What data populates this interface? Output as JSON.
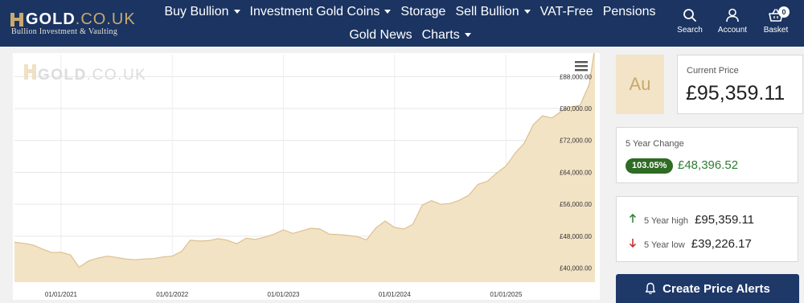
{
  "brand": {
    "name_main": "GOLD",
    "name_tld": ".CO.UK",
    "tagline": "Bullion Investment & Vaulting",
    "watermark_main": "GOLD",
    "watermark_tld": ".CO.UK"
  },
  "nav": {
    "row1": [
      {
        "label": "Buy Bullion",
        "dropdown": true
      },
      {
        "label": "Investment Gold Coins",
        "dropdown": true
      },
      {
        "label": "Storage",
        "dropdown": false
      },
      {
        "label": "Sell Bullion",
        "dropdown": true
      },
      {
        "label": "VAT-Free",
        "dropdown": false
      },
      {
        "label": "Pensions",
        "dropdown": false
      }
    ],
    "row2": [
      {
        "label": "Gold News",
        "dropdown": false
      },
      {
        "label": "Charts",
        "dropdown": true
      }
    ]
  },
  "header_icons": {
    "search_label": "Search",
    "account_label": "Account",
    "basket_label": "Basket",
    "basket_count": "0"
  },
  "metal": {
    "symbol": "Au"
  },
  "price": {
    "label": "Current Price",
    "value": "£95,359.11"
  },
  "change": {
    "label": "5 Year Change",
    "percent": "103.05%",
    "absolute": "£48,396.52"
  },
  "highlow": {
    "high_label": "5 Year high",
    "high_value": "£95,359.11",
    "low_label": "5 Year low",
    "low_value": "£39,226.17"
  },
  "alert_button": "Create Price Alerts",
  "colors": {
    "header_bg": "#1b3461",
    "area_fill": "#f3e3c5",
    "area_line": "#dcc08e",
    "positive": "#2e7d32",
    "pill_bg": "#2e6b23",
    "up_arrow": "#2e7d32",
    "down_arrow": "#c62828",
    "button_bg": "#1e3868"
  },
  "chart_data": {
    "type": "area",
    "title": "",
    "xlabel": "",
    "ylabel": "",
    "ylim": [
      36500,
      93500
    ],
    "y_ticks": [
      40000,
      48000,
      56000,
      64000,
      72000,
      80000,
      88000
    ],
    "y_tick_labels": [
      "£40,000.00",
      "£48,000.00",
      "£56,000.00",
      "£64,000.00",
      "£72,000.00",
      "£80,000.00",
      "£88,000.00"
    ],
    "x_ticks": [
      "2021-01-01",
      "2022-01-01",
      "2023-01-01",
      "2024-01-01",
      "2025-01-01"
    ],
    "x_tick_labels": [
      "01/01/2021",
      "01/01/2022",
      "01/01/2023",
      "01/01/2024",
      "01/01/2025"
    ],
    "xlim": [
      "2020-08-01",
      "2025-10-20"
    ],
    "grid": true,
    "series": [
      {
        "x": [
          "2020-08-01",
          "2020-09-01",
          "2020-10-01",
          "2020-11-01",
          "2020-12-01",
          "2021-01-01",
          "2021-02-01",
          "2021-03-01",
          "2021-04-01",
          "2021-05-01",
          "2021-06-01",
          "2021-07-01",
          "2021-08-01",
          "2021-09-01",
          "2021-10-01",
          "2021-11-01",
          "2021-12-01",
          "2022-01-01",
          "2022-02-01",
          "2022-03-01",
          "2022-04-01",
          "2022-05-01",
          "2022-06-01",
          "2022-07-01",
          "2022-08-01",
          "2022-09-01",
          "2022-10-01",
          "2022-11-01",
          "2022-12-01",
          "2023-01-01",
          "2023-02-01",
          "2023-03-01",
          "2023-04-01",
          "2023-05-01",
          "2023-06-01",
          "2023-07-01",
          "2023-08-01",
          "2023-09-01",
          "2023-10-01",
          "2023-11-01",
          "2023-12-01",
          "2024-01-01",
          "2024-02-01",
          "2024-03-01",
          "2024-04-01",
          "2024-05-01",
          "2024-06-01",
          "2024-07-01",
          "2024-08-01",
          "2024-09-01",
          "2024-10-01",
          "2024-11-01",
          "2024-12-01",
          "2025-01-01",
          "2025-02-01",
          "2025-03-01",
          "2025-04-01",
          "2025-05-01",
          "2025-06-01",
          "2025-07-01",
          "2025-08-01",
          "2025-09-01",
          "2025-10-01",
          "2025-10-20"
        ],
        "y": [
          46500,
          46200,
          45800,
          44800,
          43900,
          44000,
          43300,
          40200,
          41800,
          42500,
          43000,
          42700,
          42300,
          42100,
          42300,
          42400,
          42800,
          43000,
          44200,
          47000,
          46800,
          46900,
          47400,
          47000,
          46100,
          47500,
          47200,
          47800,
          48500,
          49600,
          48700,
          49300,
          50000,
          49800,
          48500,
          48400,
          48200,
          47900,
          47100,
          50100,
          51800,
          50200,
          49800,
          51000,
          55800,
          56900,
          56000,
          56200,
          57000,
          58300,
          61000,
          61800,
          63800,
          65600,
          68900,
          71200,
          76000,
          78200,
          77600,
          79300,
          80400,
          80800,
          86000,
          95359
        ]
      }
    ]
  }
}
